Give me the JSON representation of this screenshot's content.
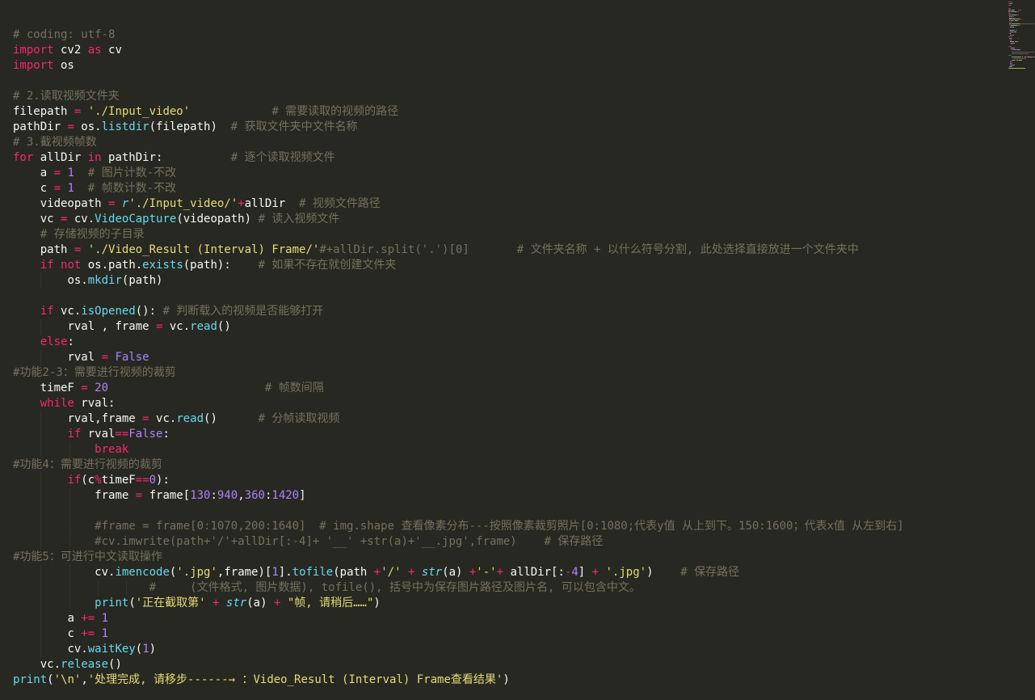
{
  "editor": {
    "colors": {
      "background": "#272822",
      "default": "#f8f8f2",
      "keyword": "#f92672",
      "string": "#e6db74",
      "number": "#ae81ff",
      "function": "#66d9ef",
      "comment": "#75715e"
    },
    "lines": [
      {
        "indent": 0,
        "tokens": [
          [
            "c",
            "# coding: utf-8"
          ]
        ]
      },
      {
        "indent": 0,
        "tokens": [
          [
            "k",
            "import"
          ],
          [
            "p",
            " cv2 "
          ],
          [
            "k",
            "as"
          ],
          [
            "p",
            " cv"
          ]
        ]
      },
      {
        "indent": 0,
        "tokens": [
          [
            "k",
            "import"
          ],
          [
            "p",
            " os"
          ]
        ]
      },
      {
        "indent": 0,
        "tokens": []
      },
      {
        "indent": 0,
        "tokens": [
          [
            "c",
            "# 2.读取视频文件夹"
          ]
        ]
      },
      {
        "indent": 0,
        "tokens": [
          [
            "p",
            "filepath "
          ],
          [
            "o",
            "="
          ],
          [
            "p",
            " "
          ],
          [
            "s",
            "'./Input_video'"
          ],
          [
            "p",
            "            "
          ],
          [
            "c",
            "# 需要读取的视频的路径"
          ]
        ]
      },
      {
        "indent": 0,
        "tokens": [
          [
            "p",
            "pathDir "
          ],
          [
            "o",
            "="
          ],
          [
            "p",
            " os."
          ],
          [
            "f",
            "listdir"
          ],
          [
            "p",
            "(filepath)  "
          ],
          [
            "c",
            "# 获取文件夹中文件名称"
          ]
        ]
      },
      {
        "indent": 0,
        "tokens": [
          [
            "c",
            "# 3.截视频帧数"
          ]
        ]
      },
      {
        "indent": 0,
        "tokens": [
          [
            "k",
            "for"
          ],
          [
            "p",
            " allDir "
          ],
          [
            "k",
            "in"
          ],
          [
            "p",
            " pathDir:          "
          ],
          [
            "c",
            "# 逐个读取视频文件"
          ]
        ]
      },
      {
        "indent": 1,
        "tokens": [
          [
            "p",
            "a "
          ],
          [
            "o",
            "="
          ],
          [
            "p",
            " "
          ],
          [
            "n",
            "1"
          ],
          [
            "p",
            "  "
          ],
          [
            "c",
            "# 图片计数-不改"
          ]
        ]
      },
      {
        "indent": 1,
        "tokens": [
          [
            "p",
            "c "
          ],
          [
            "o",
            "="
          ],
          [
            "p",
            " "
          ],
          [
            "n",
            "1"
          ],
          [
            "p",
            "  "
          ],
          [
            "c",
            "# 帧数计数-不改"
          ]
        ]
      },
      {
        "indent": 1,
        "tokens": [
          [
            "p",
            "videopath "
          ],
          [
            "o",
            "="
          ],
          [
            "p",
            " "
          ],
          [
            "b",
            "r"
          ],
          [
            "s",
            "'./Input_video/'"
          ],
          [
            "o",
            "+"
          ],
          [
            "p",
            "allDir  "
          ],
          [
            "c",
            "# 视频文件路径"
          ]
        ]
      },
      {
        "indent": 1,
        "tokens": [
          [
            "p",
            "vc "
          ],
          [
            "o",
            "="
          ],
          [
            "p",
            " cv."
          ],
          [
            "f",
            "VideoCapture"
          ],
          [
            "p",
            "(videopath) "
          ],
          [
            "c",
            "# 读入视频文件"
          ]
        ]
      },
      {
        "indent": 1,
        "tokens": [
          [
            "c",
            "# 存储视频的子目录"
          ]
        ]
      },
      {
        "indent": 1,
        "tokens": [
          [
            "p",
            "path "
          ],
          [
            "o",
            "="
          ],
          [
            "p",
            " "
          ],
          [
            "s",
            "'./Video_Result (Interval) Frame/'"
          ],
          [
            "c",
            "#+allDir.split('.')[0]       # 文件夹名称 + 以什么符号分割, 此处选择直接放进一个文件夹中"
          ]
        ]
      },
      {
        "indent": 1,
        "tokens": [
          [
            "k",
            "if"
          ],
          [
            "p",
            " "
          ],
          [
            "k",
            "not"
          ],
          [
            "p",
            " os.path."
          ],
          [
            "f",
            "exists"
          ],
          [
            "p",
            "(path):    "
          ],
          [
            "c",
            "# 如果不存在就创建文件夹"
          ]
        ]
      },
      {
        "indent": 2,
        "tokens": [
          [
            "p",
            "os."
          ],
          [
            "f",
            "mkdir"
          ],
          [
            "p",
            "(path)"
          ]
        ]
      },
      {
        "indent": 0,
        "tokens": []
      },
      {
        "indent": 1,
        "tokens": [
          [
            "k",
            "if"
          ],
          [
            "p",
            " vc."
          ],
          [
            "f",
            "isOpened"
          ],
          [
            "p",
            "(): "
          ],
          [
            "c",
            "# 判断载入的视频是否能够打开"
          ]
        ]
      },
      {
        "indent": 2,
        "tokens": [
          [
            "p",
            "rval , frame "
          ],
          [
            "o",
            "="
          ],
          [
            "p",
            " vc."
          ],
          [
            "f",
            "read"
          ],
          [
            "p",
            "()"
          ]
        ]
      },
      {
        "indent": 1,
        "tokens": [
          [
            "k",
            "else"
          ],
          [
            "p",
            ":"
          ]
        ]
      },
      {
        "indent": 2,
        "tokens": [
          [
            "p",
            "rval "
          ],
          [
            "o",
            "="
          ],
          [
            "p",
            " "
          ],
          [
            "n",
            "False"
          ]
        ]
      },
      {
        "indent": 0,
        "tokens": [
          [
            "c",
            "#功能2-3：需要进行视频的裁剪"
          ]
        ]
      },
      {
        "indent": 1,
        "tokens": [
          [
            "p",
            "timeF "
          ],
          [
            "o",
            "="
          ],
          [
            "p",
            " "
          ],
          [
            "n",
            "20"
          ],
          [
            "p",
            "                       "
          ],
          [
            "c",
            "# 帧数间隔"
          ]
        ]
      },
      {
        "indent": 1,
        "tokens": [
          [
            "k",
            "while"
          ],
          [
            "p",
            " rval:"
          ]
        ]
      },
      {
        "indent": 2,
        "tokens": [
          [
            "p",
            "rval,frame "
          ],
          [
            "o",
            "="
          ],
          [
            "p",
            " vc."
          ],
          [
            "f",
            "read"
          ],
          [
            "p",
            "()      "
          ],
          [
            "c",
            "# 分帧读取视频"
          ]
        ]
      },
      {
        "indent": 2,
        "tokens": [
          [
            "k",
            "if"
          ],
          [
            "p",
            " rval"
          ],
          [
            "o",
            "=="
          ],
          [
            "n",
            "False"
          ],
          [
            "p",
            ":"
          ]
        ]
      },
      {
        "indent": 3,
        "tokens": [
          [
            "k",
            "break"
          ]
        ]
      },
      {
        "indent": 0,
        "tokens": [
          [
            "c",
            "#功能4：需要进行视频的裁剪"
          ]
        ]
      },
      {
        "indent": 2,
        "tokens": [
          [
            "k",
            "if"
          ],
          [
            "p",
            "(c"
          ],
          [
            "o",
            "%"
          ],
          [
            "p",
            "timeF"
          ],
          [
            "o",
            "=="
          ],
          [
            "n",
            "0"
          ],
          [
            "p",
            "):"
          ]
        ]
      },
      {
        "indent": 3,
        "tokens": [
          [
            "p",
            "frame "
          ],
          [
            "o",
            "="
          ],
          [
            "p",
            " frame["
          ],
          [
            "n",
            "130"
          ],
          [
            "p",
            ":"
          ],
          [
            "n",
            "940"
          ],
          [
            "p",
            ","
          ],
          [
            "n",
            "360"
          ],
          [
            "p",
            ":"
          ],
          [
            "n",
            "1420"
          ],
          [
            "p",
            "]"
          ]
        ]
      },
      {
        "indent": 0,
        "tokens": []
      },
      {
        "indent": 3,
        "tokens": [
          [
            "c",
            "#frame = frame[0:1070,200:1640]  # img.shape 查看像素分布---按照像素裁剪照片[0:1080;代表y值 从上到下。150:1600；代表x值 从左到右]"
          ]
        ]
      },
      {
        "indent": 3,
        "tokens": [
          [
            "c",
            "#cv.imwrite(path+'/'+allDir[:-4]+ '__' +str(a)+'__.jpg',frame)    # 保存路径"
          ]
        ]
      },
      {
        "indent": 0,
        "tokens": [
          [
            "c",
            "#功能5：可进行中文读取操作"
          ]
        ]
      },
      {
        "indent": 3,
        "tokens": [
          [
            "p",
            "cv."
          ],
          [
            "f",
            "imencode"
          ],
          [
            "p",
            "("
          ],
          [
            "s",
            "'.jpg'"
          ],
          [
            "p",
            ",frame)["
          ],
          [
            "n",
            "1"
          ],
          [
            "p",
            "]."
          ],
          [
            "f",
            "tofile"
          ],
          [
            "p",
            "(path "
          ],
          [
            "o",
            "+"
          ],
          [
            "s",
            "'/'"
          ],
          [
            "p",
            " "
          ],
          [
            "o",
            "+"
          ],
          [
            "p",
            " "
          ],
          [
            "b",
            "str"
          ],
          [
            "p",
            "(a) "
          ],
          [
            "o",
            "+"
          ],
          [
            "s",
            "'-'"
          ],
          [
            "o",
            "+"
          ],
          [
            "p",
            " allDir[:"
          ],
          [
            "o",
            "-"
          ],
          [
            "n",
            "4"
          ],
          [
            "p",
            "] "
          ],
          [
            "o",
            "+"
          ],
          [
            "p",
            " "
          ],
          [
            "s",
            "'.jpg'"
          ],
          [
            "p",
            ")    "
          ],
          [
            "c",
            "# 保存路径"
          ]
        ]
      },
      {
        "indent": 5,
        "tokens": [
          [
            "c",
            "#     (文件格式, 图片数据), tofile(), 括号中为保存图片路径及图片名, 可以包含中文。"
          ]
        ]
      },
      {
        "indent": 3,
        "tokens": [
          [
            "f",
            "print"
          ],
          [
            "p",
            "("
          ],
          [
            "s",
            "'正在截取第'"
          ],
          [
            "p",
            " "
          ],
          [
            "o",
            "+"
          ],
          [
            "p",
            " "
          ],
          [
            "b",
            "str"
          ],
          [
            "p",
            "(a) "
          ],
          [
            "o",
            "+"
          ],
          [
            "p",
            " "
          ],
          [
            "s",
            "\"帧, 请稍后……\""
          ],
          [
            "p",
            ")"
          ]
        ]
      },
      {
        "indent": 2,
        "tokens": [
          [
            "p",
            "a "
          ],
          [
            "o",
            "+="
          ],
          [
            "p",
            " "
          ],
          [
            "n",
            "1"
          ]
        ]
      },
      {
        "indent": 2,
        "tokens": [
          [
            "p",
            "c "
          ],
          [
            "o",
            "+="
          ],
          [
            "p",
            " "
          ],
          [
            "n",
            "1"
          ]
        ]
      },
      {
        "indent": 2,
        "tokens": [
          [
            "p",
            "cv."
          ],
          [
            "f",
            "waitKey"
          ],
          [
            "p",
            "("
          ],
          [
            "n",
            "1"
          ],
          [
            "p",
            ")"
          ]
        ]
      },
      {
        "indent": 1,
        "tokens": [
          [
            "p",
            "vc."
          ],
          [
            "f",
            "release"
          ],
          [
            "p",
            "()"
          ]
        ]
      },
      {
        "indent": 0,
        "tokens": [
          [
            "f",
            "print"
          ],
          [
            "p",
            "("
          ],
          [
            "s",
            "'\\n'"
          ],
          [
            "p",
            ","
          ],
          [
            "s",
            "'处理完成, 请移步------→ ：Video_Result (Interval) Frame查看结果'"
          ],
          [
            "p",
            ")"
          ]
        ]
      }
    ]
  }
}
